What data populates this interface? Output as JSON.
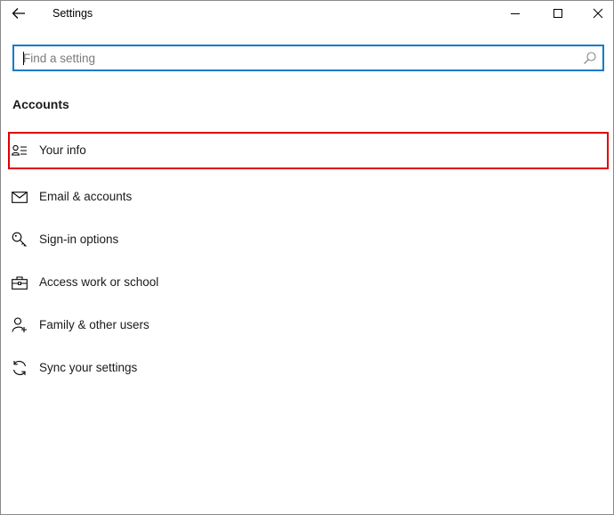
{
  "window": {
    "title": "Settings",
    "back_icon": "back-arrow-icon",
    "controls": [
      "minimize-icon",
      "maximize-icon",
      "close-icon"
    ]
  },
  "search": {
    "placeholder": "Find a setting",
    "value": "",
    "icon": "search-icon",
    "accent_color": "#0f7bc9"
  },
  "section": {
    "title": "Accounts"
  },
  "nav": {
    "items": [
      {
        "label": "Your info",
        "icon": "person-info-icon",
        "selected": true
      },
      {
        "label": "Email & accounts",
        "icon": "mail-icon",
        "selected": false
      },
      {
        "label": "Sign-in options",
        "icon": "key-icon",
        "selected": false
      },
      {
        "label": "Access work or school",
        "icon": "briefcase-icon",
        "selected": false
      },
      {
        "label": "Family & other users",
        "icon": "person-add-icon",
        "selected": false
      },
      {
        "label": "Sync your settings",
        "icon": "sync-icon",
        "selected": false
      }
    ],
    "highlight_color": "#e00000"
  }
}
